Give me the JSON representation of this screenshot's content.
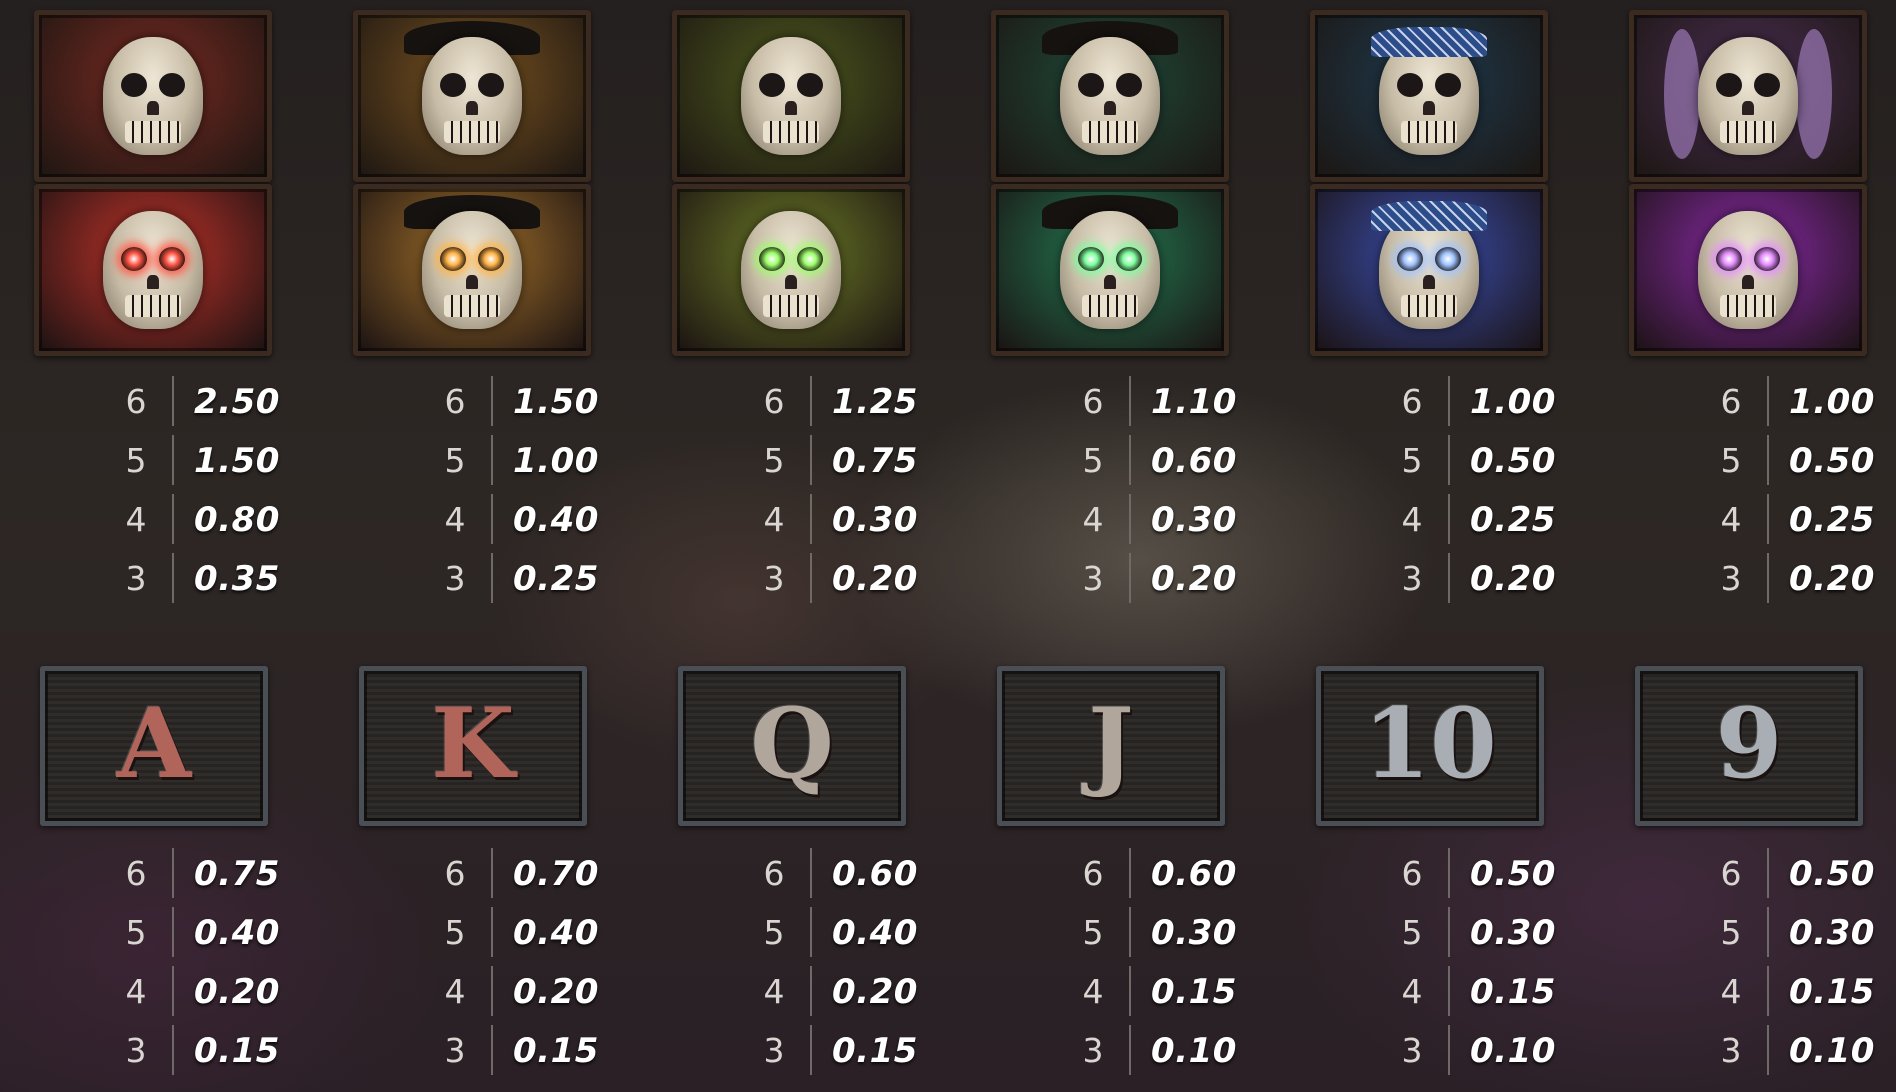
{
  "characters": [
    {
      "icon": "red-haired-skeleton-icon",
      "glow_icon": "red-skeleton-glowing-eyes-icon",
      "tile_color": "#7a2a22",
      "glow_color": "#c2332a",
      "eye_glow": "#ff5544",
      "pays": [
        {
          "count": "6",
          "value": "2.50"
        },
        {
          "count": "5",
          "value": "1.50"
        },
        {
          "count": "4",
          "value": "0.80"
        },
        {
          "count": "3",
          "value": "0.35"
        }
      ]
    },
    {
      "icon": "hat-zombie-icon",
      "glow_icon": "hat-skeleton-glowing-eyes-icon",
      "tile_color": "#7a5320",
      "glow_color": "#a2702a",
      "eye_glow": "#ffb347",
      "pays": [
        {
          "count": "6",
          "value": "1.50"
        },
        {
          "count": "5",
          "value": "1.00"
        },
        {
          "count": "4",
          "value": "0.40"
        },
        {
          "count": "3",
          "value": "0.25"
        }
      ]
    },
    {
      "icon": "green-zombie-icon",
      "glow_icon": "green-skeleton-glowing-eyes-icon",
      "tile_color": "#4e5a1e",
      "glow_color": "#6c7a26",
      "eye_glow": "#9dff6a",
      "pays": [
        {
          "count": "6",
          "value": "1.25"
        },
        {
          "count": "5",
          "value": "0.75"
        },
        {
          "count": "4",
          "value": "0.30"
        },
        {
          "count": "3",
          "value": "0.20"
        }
      ]
    },
    {
      "icon": "teal-zombie-icon",
      "glow_icon": "teal-skeleton-glowing-eyes-icon",
      "tile_color": "#1f4a3a",
      "glow_color": "#237a52",
      "eye_glow": "#7dff9c",
      "pays": [
        {
          "count": "6",
          "value": "1.10"
        },
        {
          "count": "5",
          "value": "0.60"
        },
        {
          "count": "4",
          "value": "0.30"
        },
        {
          "count": "3",
          "value": "0.20"
        }
      ]
    },
    {
      "icon": "bandana-zombie-icon",
      "glow_icon": "bandana-skeleton-glowing-eyes-icon",
      "tile_color": "#1e3a4e",
      "glow_color": "#3b4fb0",
      "eye_glow": "#9fc3ff",
      "pays": [
        {
          "count": "6",
          "value": "1.00"
        },
        {
          "count": "5",
          "value": "0.50"
        },
        {
          "count": "4",
          "value": "0.25"
        },
        {
          "count": "3",
          "value": "0.20"
        }
      ]
    },
    {
      "icon": "purple-haired-zombie-icon",
      "glow_icon": "eyepatch-skeleton-glowing-icon",
      "tile_color": "#4a2e52",
      "glow_color": "#8b2aa8",
      "eye_glow": "#e38bff",
      "pays": [
        {
          "count": "6",
          "value": "1.00"
        },
        {
          "count": "5",
          "value": "0.50"
        },
        {
          "count": "4",
          "value": "0.25"
        },
        {
          "count": "3",
          "value": "0.20"
        }
      ]
    }
  ],
  "cards": [
    {
      "glyph": "A",
      "icon": "card-a-icon",
      "color": "#b0645a",
      "pays": [
        {
          "count": "6",
          "value": "0.75"
        },
        {
          "count": "5",
          "value": "0.40"
        },
        {
          "count": "4",
          "value": "0.20"
        },
        {
          "count": "3",
          "value": "0.15"
        }
      ]
    },
    {
      "glyph": "K",
      "icon": "card-k-icon",
      "color": "#b0645a",
      "pays": [
        {
          "count": "6",
          "value": "0.70"
        },
        {
          "count": "5",
          "value": "0.40"
        },
        {
          "count": "4",
          "value": "0.20"
        },
        {
          "count": "3",
          "value": "0.15"
        }
      ]
    },
    {
      "glyph": "Q",
      "icon": "card-q-icon",
      "color": "#b0a69c",
      "pays": [
        {
          "count": "6",
          "value": "0.60"
        },
        {
          "count": "5",
          "value": "0.40"
        },
        {
          "count": "4",
          "value": "0.20"
        },
        {
          "count": "3",
          "value": "0.15"
        }
      ]
    },
    {
      "glyph": "J",
      "icon": "card-j-icon",
      "color": "#b0a69c",
      "pays": [
        {
          "count": "6",
          "value": "0.60"
        },
        {
          "count": "5",
          "value": "0.30"
        },
        {
          "count": "4",
          "value": "0.15"
        },
        {
          "count": "3",
          "value": "0.10"
        }
      ]
    },
    {
      "glyph": "10",
      "icon": "card-10-icon",
      "color": "#a9aeb4",
      "pays": [
        {
          "count": "6",
          "value": "0.50"
        },
        {
          "count": "5",
          "value": "0.30"
        },
        {
          "count": "4",
          "value": "0.15"
        },
        {
          "count": "3",
          "value": "0.10"
        }
      ]
    },
    {
      "glyph": "9",
      "icon": "card-9-icon",
      "color": "#a9aeb4",
      "pays": [
        {
          "count": "6",
          "value": "0.50"
        },
        {
          "count": "5",
          "value": "0.30"
        },
        {
          "count": "4",
          "value": "0.15"
        },
        {
          "count": "3",
          "value": "0.10"
        }
      ]
    }
  ]
}
